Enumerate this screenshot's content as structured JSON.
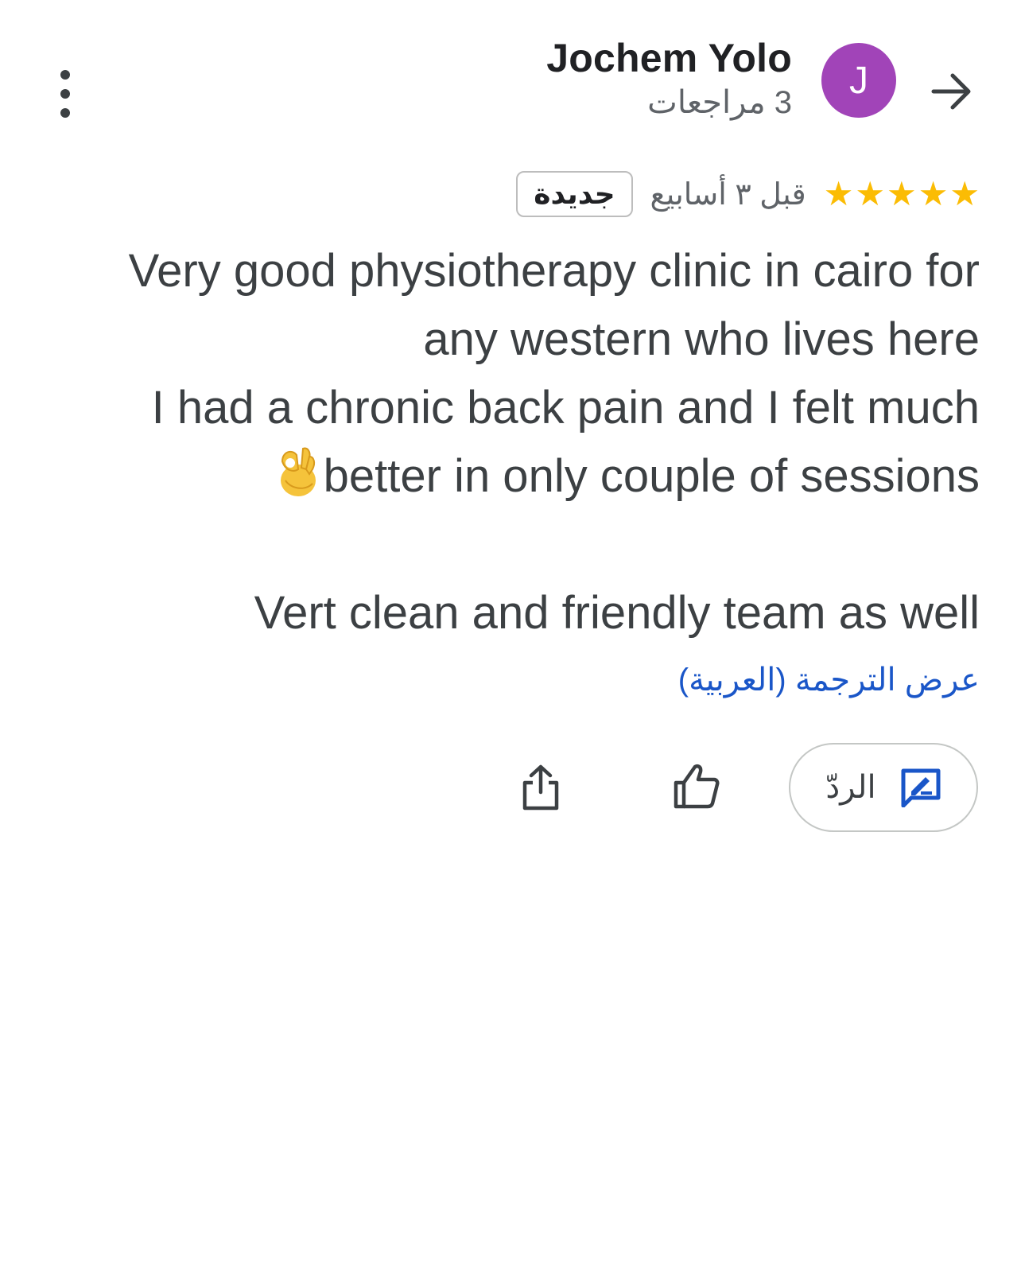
{
  "header": {
    "author_name": "Jochem Yolo",
    "review_count": "3 مراجعات",
    "avatar_letter": "J",
    "avatar_color": "#a144b8"
  },
  "review": {
    "rating": 5,
    "time": "قبل ٣ أسابيع",
    "badge": "جديدة",
    "lines": [
      "Very good physiotherapy clinic in cairo for",
      "any western who lives here",
      "I had a chronic back pain and I felt much",
      "better in only couple of sessions",
      "Vert clean and friendly team as well"
    ],
    "translate_link": "عرض الترجمة (العربية)"
  },
  "actions": {
    "reply_label": "الردّ"
  },
  "icons": {
    "menu": "more-vert-icon",
    "back": "arrow-right-icon",
    "reply": "rate-review-icon",
    "like": "thumb-up-icon",
    "share": "share-icon",
    "emoji": "ok-hand-emoji"
  },
  "colors": {
    "star": "#fbbc04",
    "link": "#1a56c8",
    "accent_icon": "#1a56c8"
  }
}
